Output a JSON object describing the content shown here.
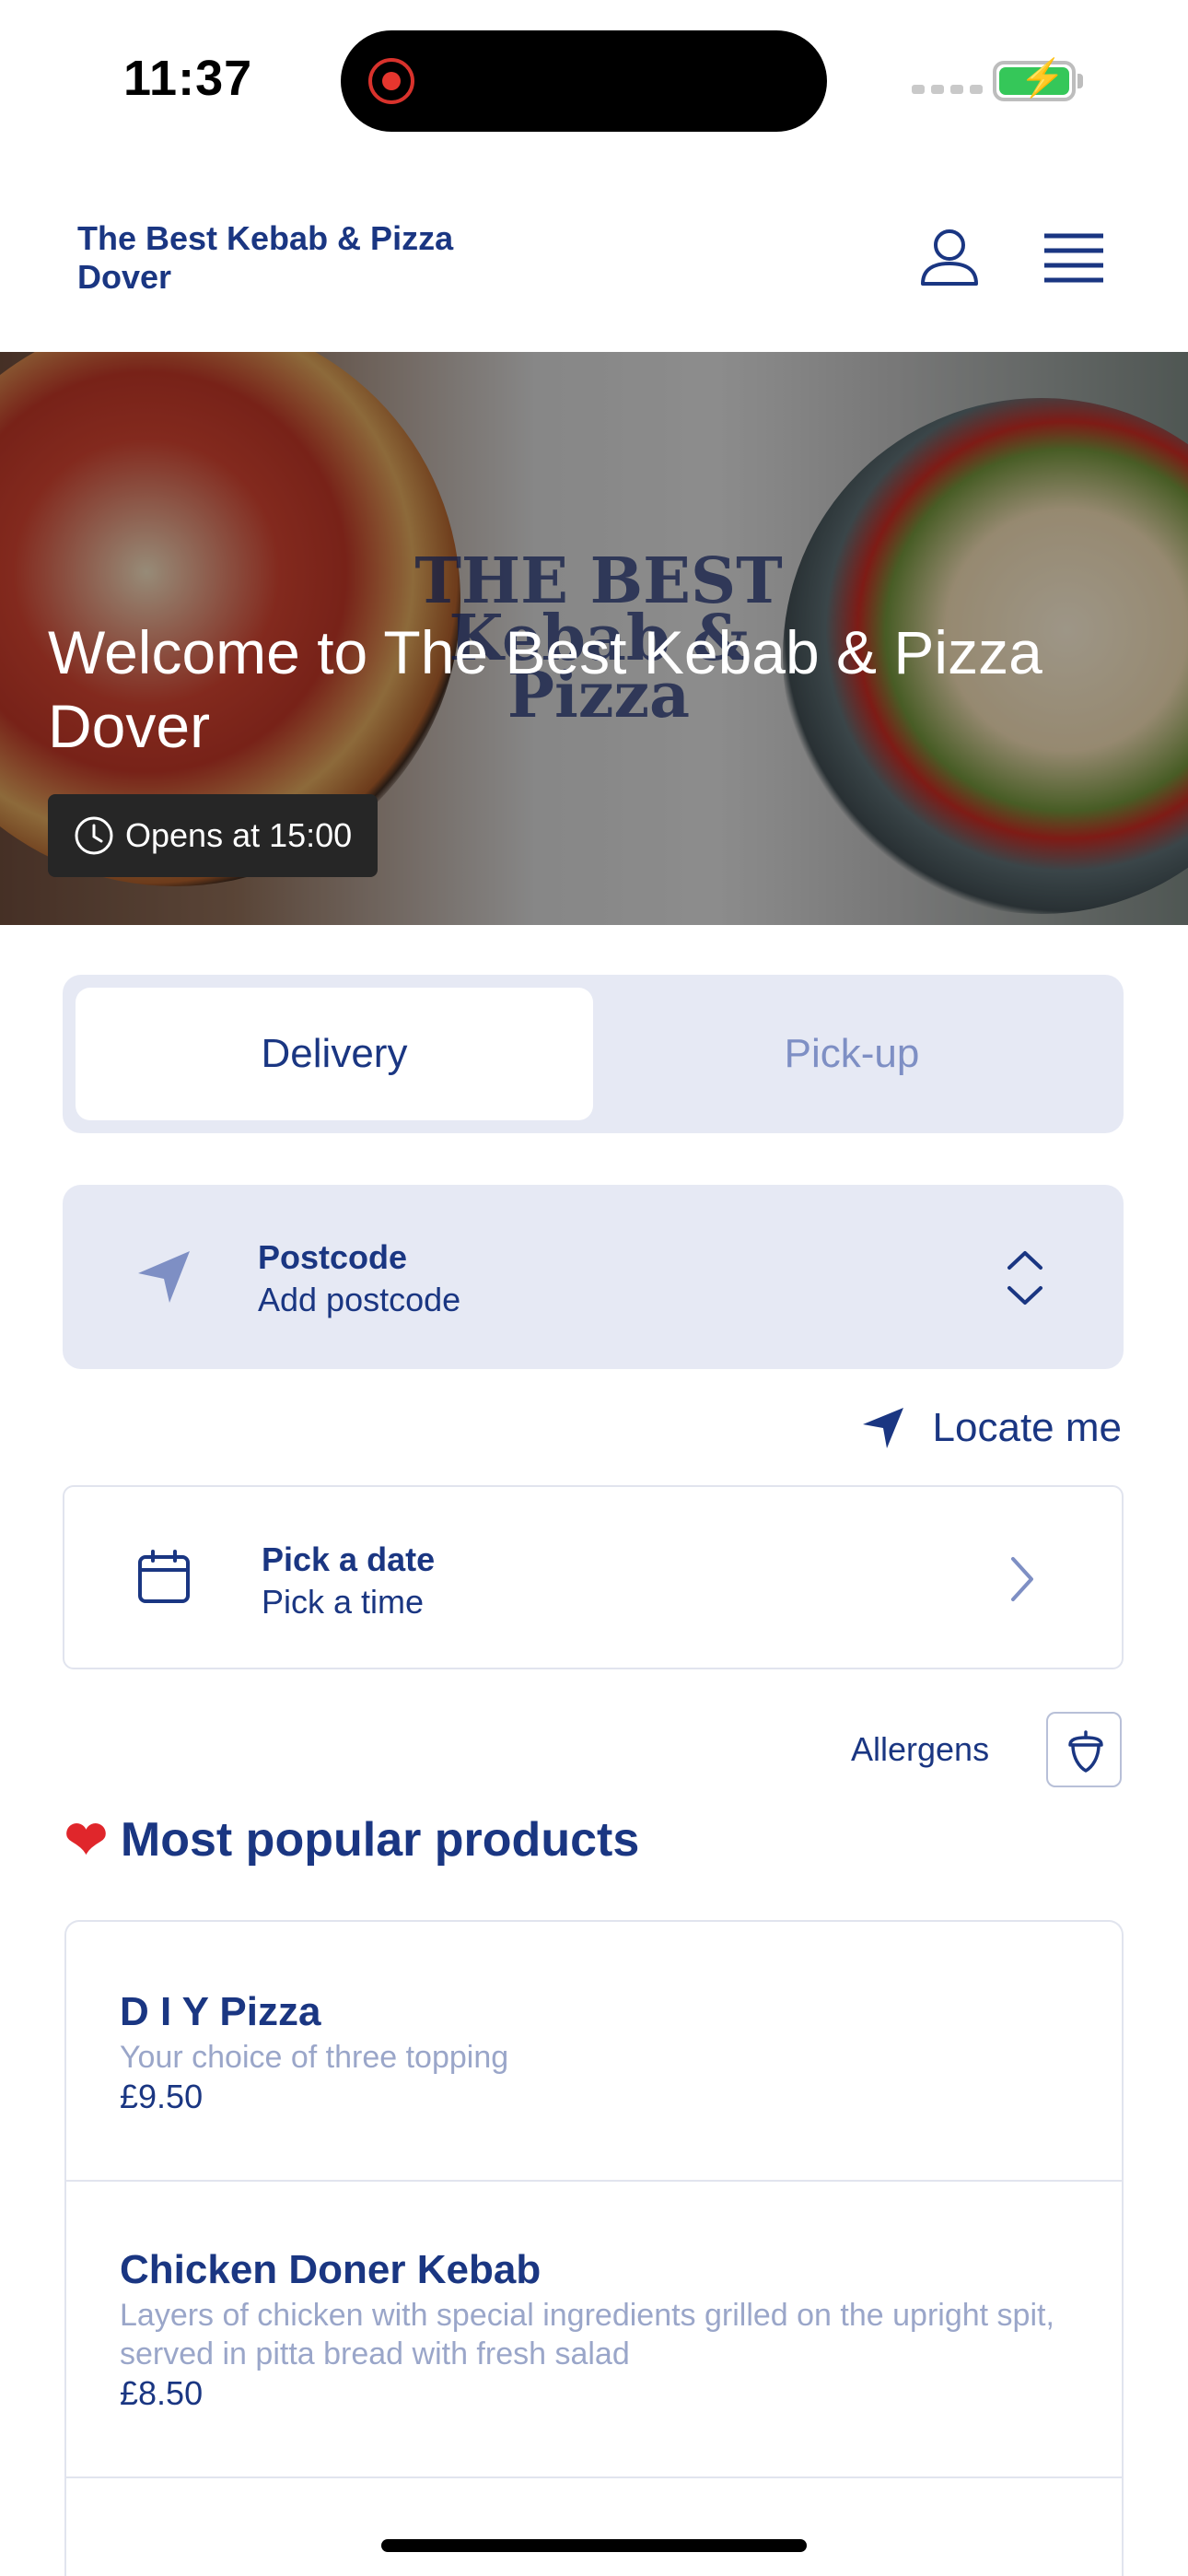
{
  "status_bar": {
    "time": "11:37"
  },
  "header": {
    "brand": "The Best Kebab & Pizza Dover"
  },
  "hero": {
    "logo_text_1": "THE BEST",
    "logo_text_2": "Kebab & Pizza",
    "title": "Welcome to The Best Kebab & Pizza Dover",
    "opening_status": "Opens at 15:00"
  },
  "order_mode": {
    "delivery_label": "Delivery",
    "pickup_label": "Pick-up",
    "selected": "Delivery"
  },
  "postcode": {
    "label": "Postcode",
    "value": "Add postcode"
  },
  "locate": {
    "label": "Locate me"
  },
  "schedule": {
    "date_label": "Pick a date",
    "time_label": "Pick a time"
  },
  "allergens": {
    "label": "Allergens"
  },
  "popular": {
    "title": "Most popular products",
    "products": [
      {
        "name": "D I Y Pizza",
        "description": "Your choice of three topping",
        "price": "£9.50"
      },
      {
        "name": "Chicken Doner Kebab",
        "description": "Layers of chicken with special ingredients grilled on the upright spit, served in pitta bread with fresh salad",
        "price": "£8.50"
      }
    ]
  },
  "colors": {
    "brand": "#1a3682",
    "muted": "#7e8fc4",
    "panel": "#e6e9f4",
    "heart": "#e0262b"
  }
}
